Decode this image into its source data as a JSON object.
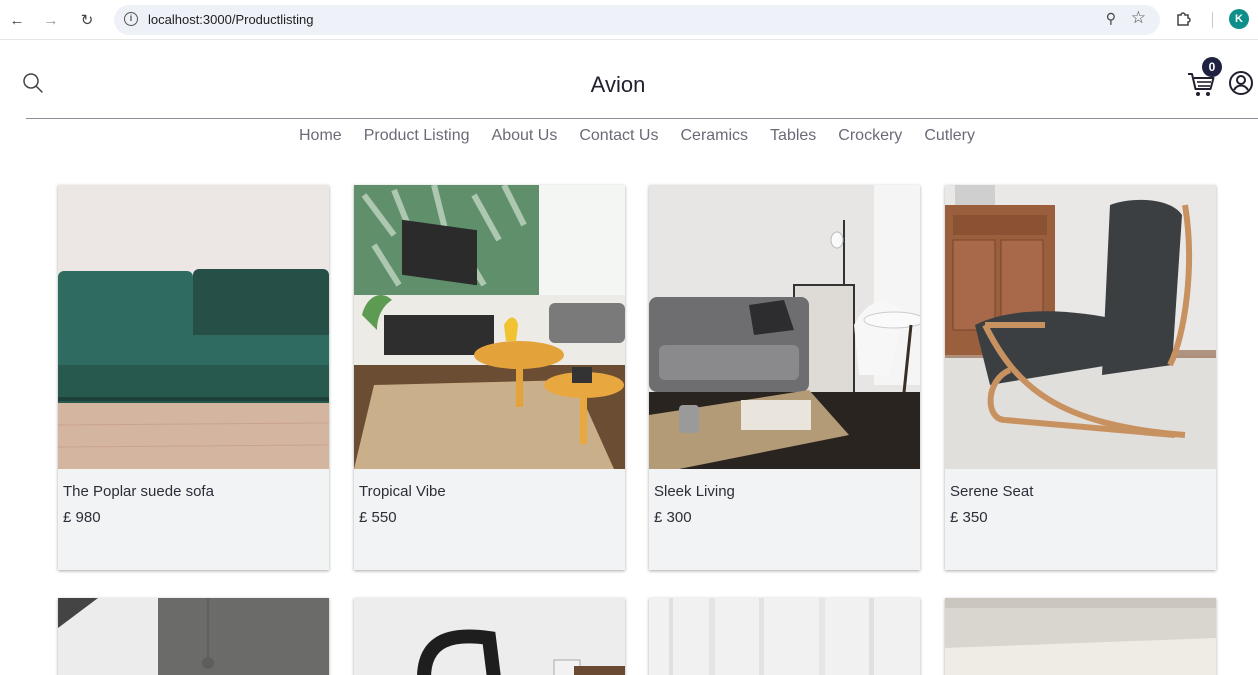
{
  "browser": {
    "url": "localhost:3000/Productlisting",
    "profile_initial": "K"
  },
  "header": {
    "brand": "Avion",
    "cart_count": "0"
  },
  "nav": {
    "items": [
      {
        "label": "Home"
      },
      {
        "label": "Product Listing"
      },
      {
        "label": "About Us"
      },
      {
        "label": "Contact Us"
      },
      {
        "label": "Ceramics"
      },
      {
        "label": "Tables"
      },
      {
        "label": "Crockery"
      },
      {
        "label": "Cutlery"
      }
    ]
  },
  "products": [
    {
      "name": "The Poplar suede sofa",
      "price": "£ 980"
    },
    {
      "name": "Tropical Vibe",
      "price": "£ 550"
    },
    {
      "name": "Sleek Living",
      "price": "£ 300"
    },
    {
      "name": "Serene Seat",
      "price": "£ 350"
    }
  ],
  "colors": {
    "accent": "#1f2140",
    "card_bg": "#f2f3f5",
    "profile": "#0f8f8a"
  }
}
